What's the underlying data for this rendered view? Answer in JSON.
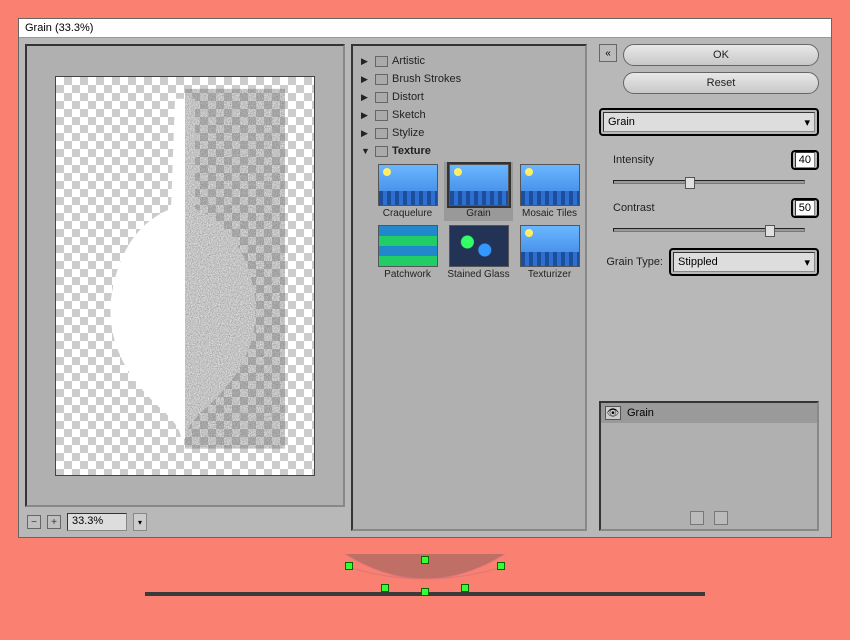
{
  "title": "Grain (33.3%)",
  "zoom": "33.3%",
  "categories": [
    {
      "label": "Artistic",
      "open": false
    },
    {
      "label": "Brush Strokes",
      "open": false
    },
    {
      "label": "Distort",
      "open": false
    },
    {
      "label": "Sketch",
      "open": false
    },
    {
      "label": "Stylize",
      "open": false
    },
    {
      "label": "Texture",
      "open": true
    }
  ],
  "texture_filters": [
    {
      "label": "Craquelure",
      "selected": false
    },
    {
      "label": "Grain",
      "selected": true
    },
    {
      "label": "Mosaic Tiles",
      "selected": false
    },
    {
      "label": "Patchwork",
      "selected": false
    },
    {
      "label": "Stained Glass",
      "selected": false
    },
    {
      "label": "Texturizer",
      "selected": false
    }
  ],
  "buttons": {
    "ok": "OK",
    "reset": "Reset"
  },
  "filter_select": "Grain",
  "params": {
    "intensity": {
      "label": "Intensity",
      "value": 40,
      "pct": 40
    },
    "contrast": {
      "label": "Contrast",
      "value": 50,
      "pct": 82
    }
  },
  "grain_type": {
    "label": "Grain Type:",
    "value": "Stippled"
  },
  "layer": {
    "name": "Grain"
  }
}
